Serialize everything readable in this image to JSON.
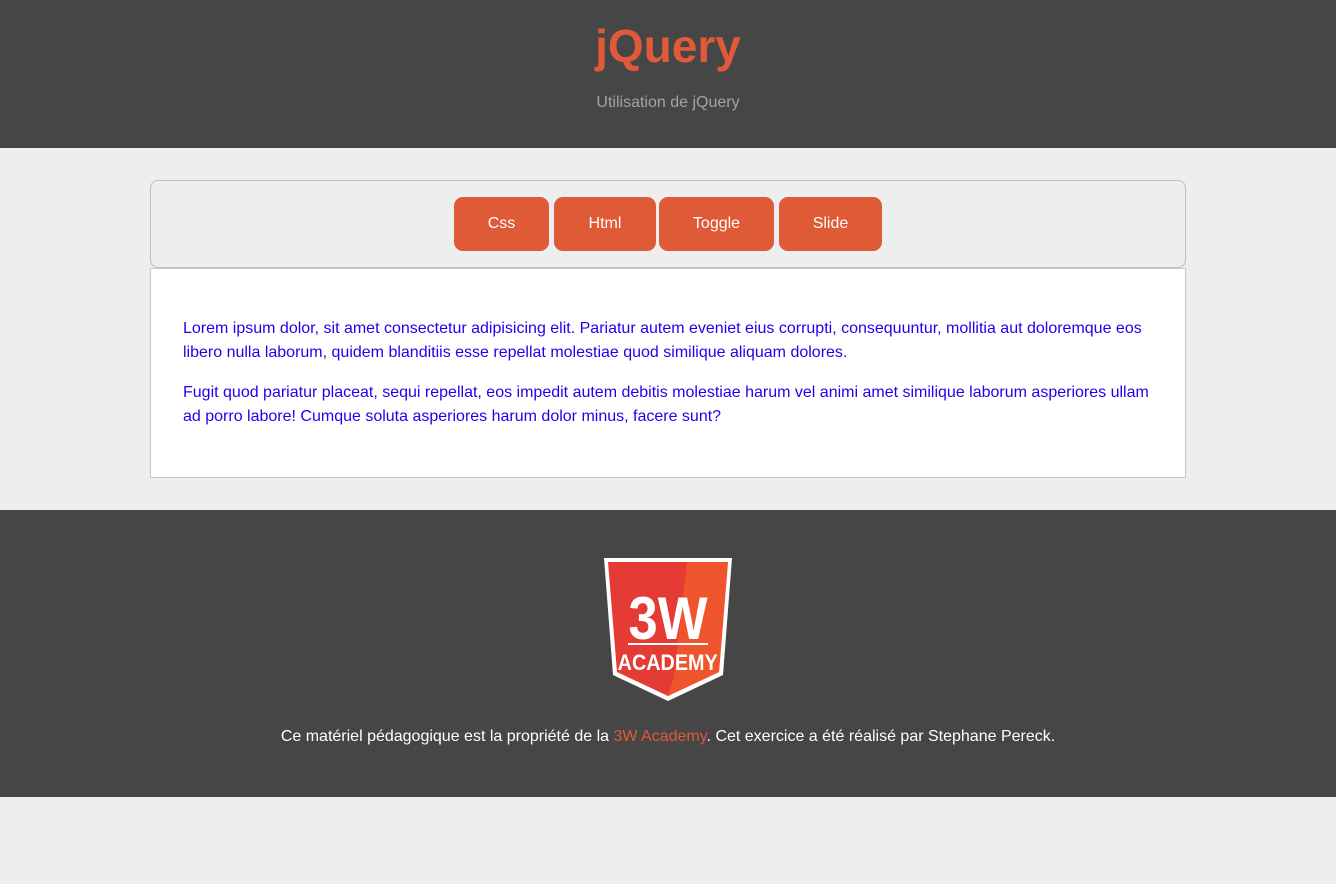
{
  "header": {
    "title": "jQuery",
    "subtitle": "Utilisation de jQuery"
  },
  "toolbar": {
    "buttons": [
      {
        "label": "Css"
      },
      {
        "label": "Html"
      },
      {
        "label": "Toggle"
      },
      {
        "label": "Slide"
      }
    ]
  },
  "content": {
    "paragraphs": [
      "Lorem ipsum dolor, sit amet consectetur adipisicing elit. Pariatur autem eveniet eius corrupti, consequuntur, mollitia aut doloremque eos libero nulla laborum, quidem blanditiis esse repellat molestiae quod similique aliquam dolores.",
      "Fugit quod pariatur placeat, sequi repellat, eos impedit autem debitis molestiae harum vel animi amet similique laborum asperiores ullam ad porro labore! Cumque soluta asperiores harum dolor minus, facere sunt?"
    ]
  },
  "footer": {
    "logo": {
      "line1": "3W",
      "line2": "ACADEMY"
    },
    "text_before": "Ce matériel pédagogique est la propriété de la ",
    "link_text": "3W Academy",
    "text_after": ". Cet exercice a été réalisé par Stephane Pereck."
  },
  "colors": {
    "header_bg": "#464646",
    "accent": "#e05a39",
    "button_bg": "#df5a37",
    "paragraph_text": "#2200ee",
    "page_bg": "#eeeeee"
  }
}
